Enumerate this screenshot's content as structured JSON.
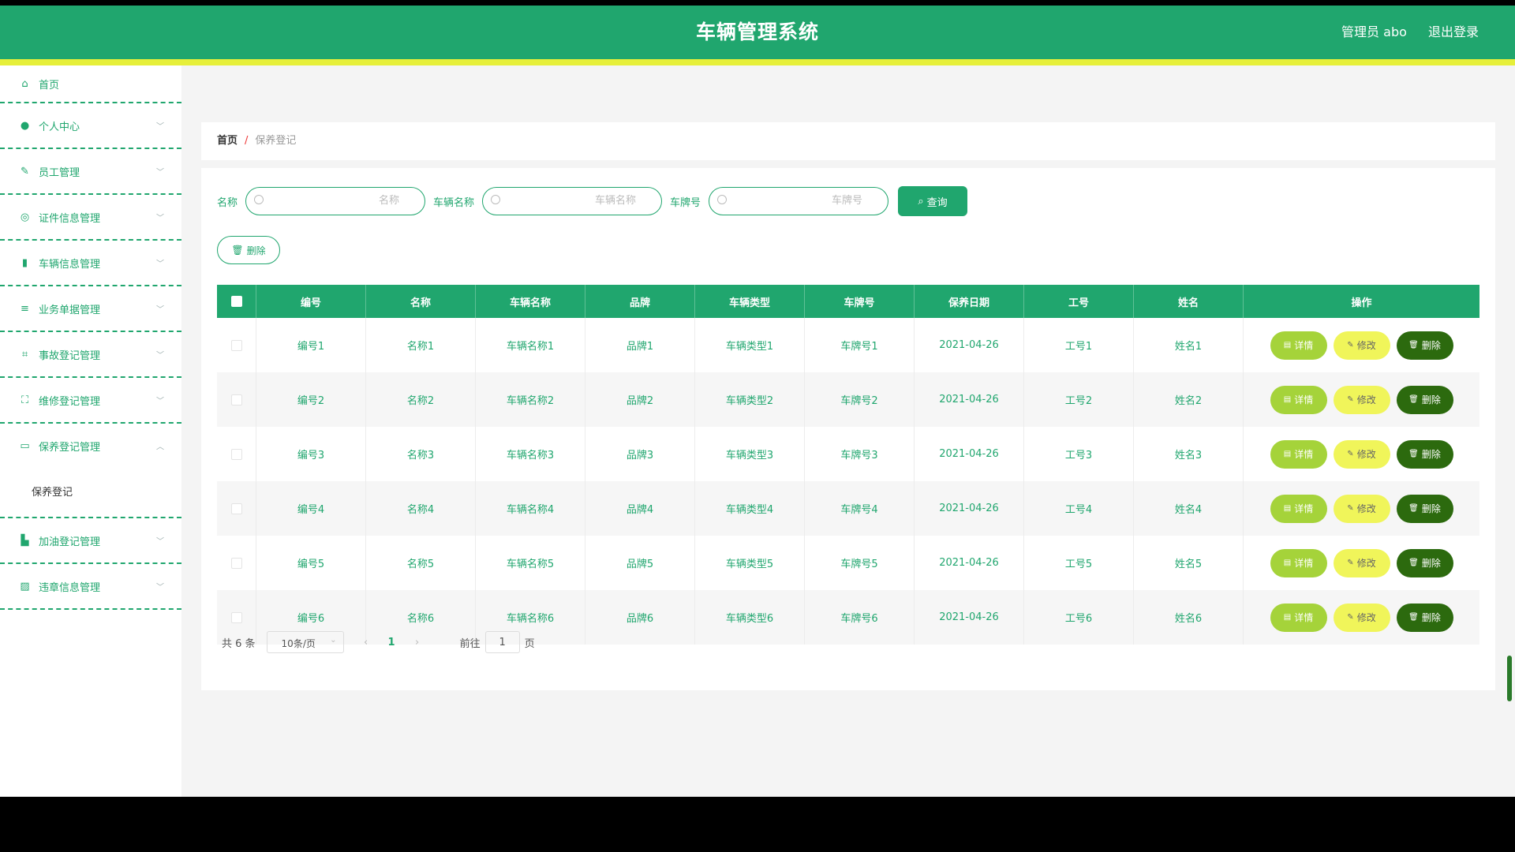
{
  "app": {
    "title": "车辆管理系统",
    "user_label": "管理员 abo",
    "logout_label": "退出登录"
  },
  "colors": {
    "primary": "#20a66e",
    "accent": "#e6ef3a",
    "detail": "#a5d33a",
    "edit": "#f0f55a",
    "delete": "#2c6a0e"
  },
  "sidebar": {
    "items": [
      {
        "label": "首页",
        "icon": "home-icon"
      },
      {
        "label": "个人中心",
        "icon": "user-icon"
      },
      {
        "label": "员工管理",
        "icon": "staff-icon"
      },
      {
        "label": "证件信息管理",
        "icon": "certificate-icon"
      },
      {
        "label": "车辆信息管理",
        "icon": "vehicle-icon"
      },
      {
        "label": "业务单据管理",
        "icon": "list-icon"
      },
      {
        "label": "事故登记管理",
        "icon": "crop-icon"
      },
      {
        "label": "维修登记管理",
        "icon": "expand-icon"
      },
      {
        "label": "保养登记管理",
        "icon": "maintenance-icon"
      },
      {
        "label": "加油登记管理",
        "icon": "fuel-icon"
      },
      {
        "label": "违章信息管理",
        "icon": "chart-icon"
      }
    ],
    "submenu": {
      "label": "保养登记"
    }
  },
  "breadcrumb": {
    "home": "首页",
    "separator": "/",
    "current": "保养登记"
  },
  "search": {
    "name_label": "名称",
    "name_placeholder": "名称",
    "vehicle_label": "车辆名称",
    "vehicle_placeholder": "车辆名称",
    "plate_label": "车牌号",
    "plate_placeholder": "车牌号",
    "query_label": "查询"
  },
  "bulk_delete_label": "删除",
  "table": {
    "headers": [
      "编号",
      "名称",
      "车辆名称",
      "品牌",
      "车辆类型",
      "车牌号",
      "保养日期",
      "工号",
      "姓名",
      "操作"
    ],
    "rows": [
      [
        "编号1",
        "名称1",
        "车辆名称1",
        "品牌1",
        "车辆类型1",
        "车牌号1",
        "2021-04-26",
        "工号1",
        "姓名1"
      ],
      [
        "编号2",
        "名称2",
        "车辆名称2",
        "品牌2",
        "车辆类型2",
        "车牌号2",
        "2021-04-26",
        "工号2",
        "姓名2"
      ],
      [
        "编号3",
        "名称3",
        "车辆名称3",
        "品牌3",
        "车辆类型3",
        "车牌号3",
        "2021-04-26",
        "工号3",
        "姓名3"
      ],
      [
        "编号4",
        "名称4",
        "车辆名称4",
        "品牌4",
        "车辆类型4",
        "车牌号4",
        "2021-04-26",
        "工号4",
        "姓名4"
      ],
      [
        "编号5",
        "名称5",
        "车辆名称5",
        "品牌5",
        "车辆类型5",
        "车牌号5",
        "2021-04-26",
        "工号5",
        "姓名5"
      ],
      [
        "编号6",
        "名称6",
        "车辆名称6",
        "品牌6",
        "车辆类型6",
        "车牌号6",
        "2021-04-26",
        "工号6",
        "姓名6"
      ]
    ],
    "actions": {
      "detail": "详情",
      "edit": "修改",
      "delete": "删除"
    }
  },
  "pagination": {
    "total": "共 6 条",
    "page_size": "10条/页",
    "current_page": "1",
    "goto_label": "前往",
    "goto_value": "1",
    "page_suffix": "页"
  }
}
